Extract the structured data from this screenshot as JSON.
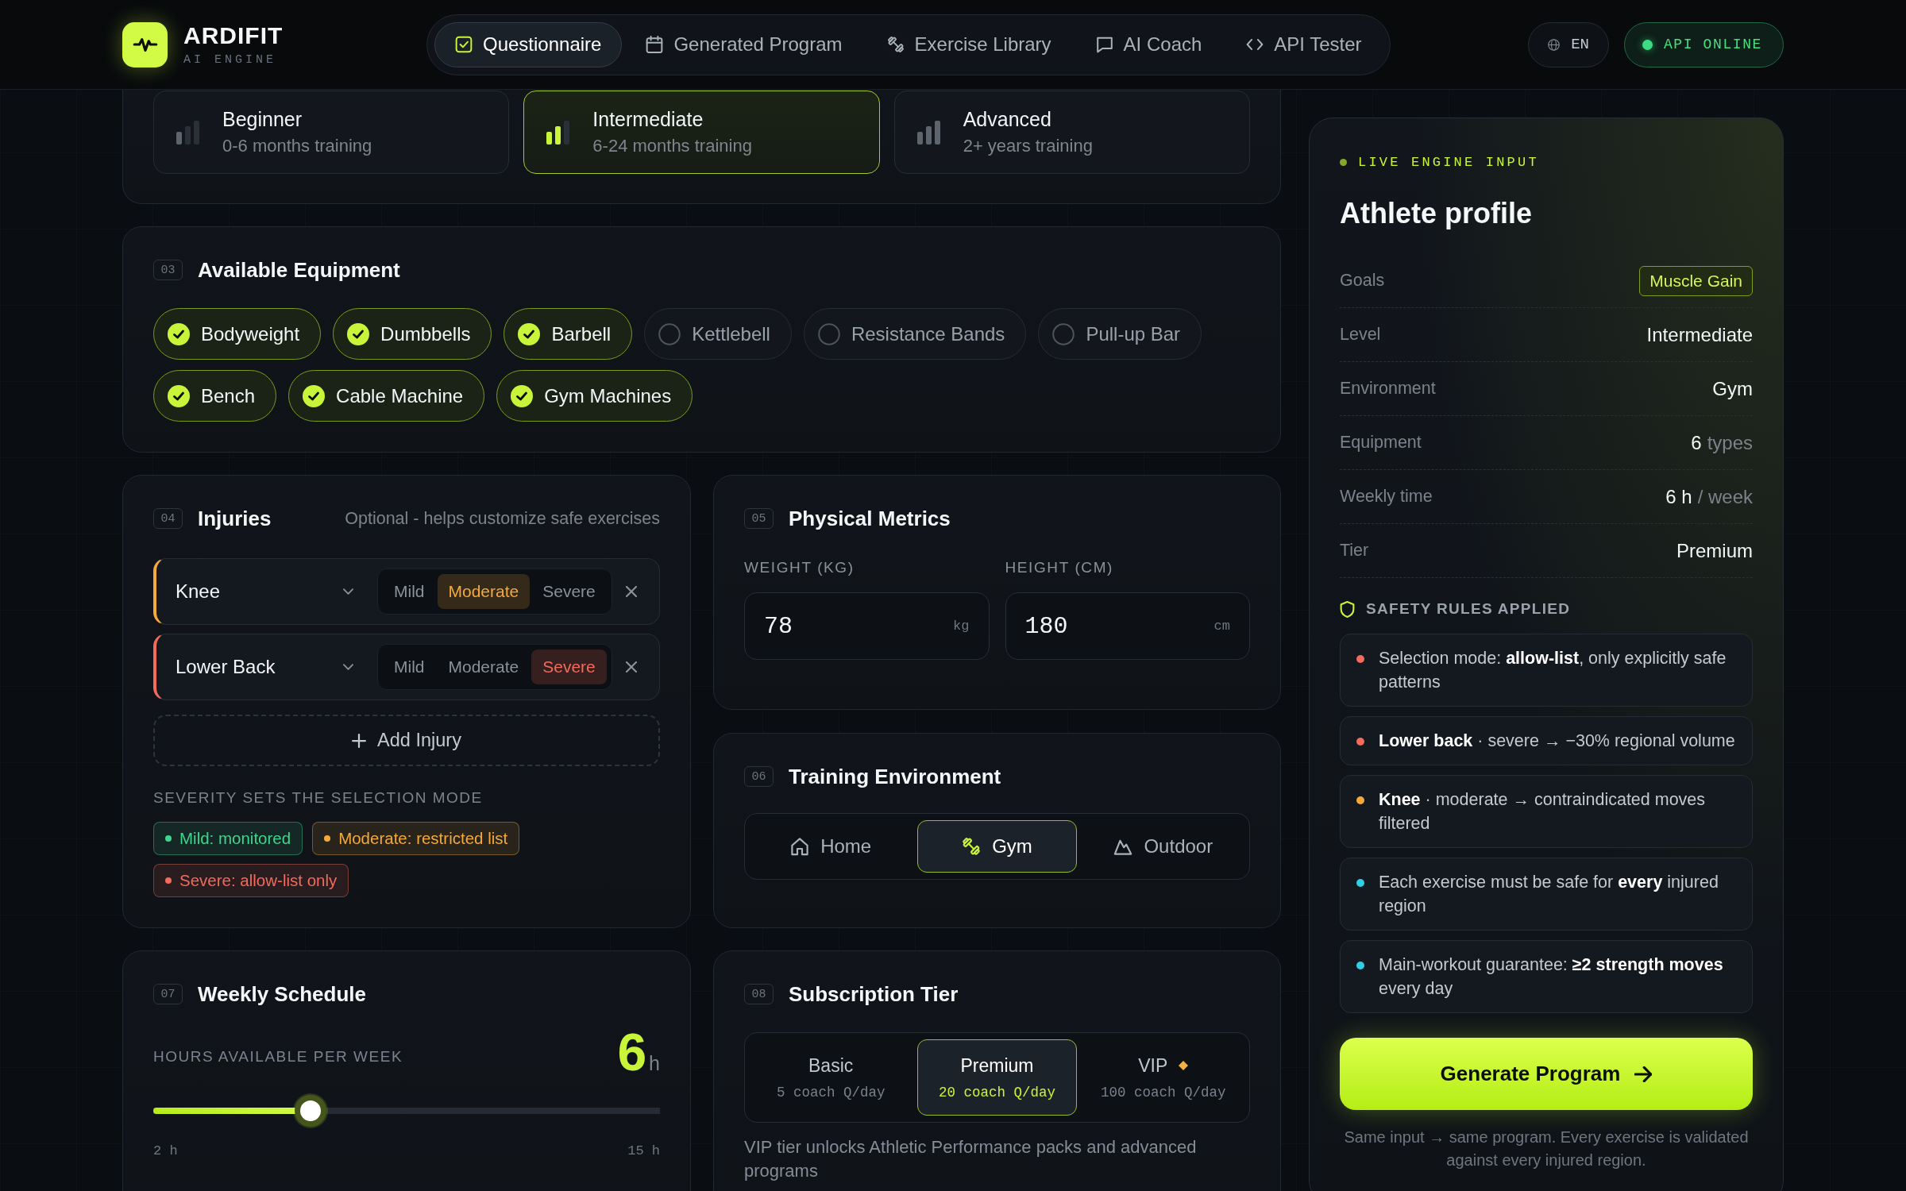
{
  "header": {
    "brand": {
      "name": "ARDIFIT",
      "tagline": "AI ENGINE"
    },
    "nav": [
      {
        "label": "Questionnaire",
        "selected": true
      },
      {
        "label": "Generated Program",
        "selected": false
      },
      {
        "label": "Exercise Library",
        "selected": false
      },
      {
        "label": "AI Coach",
        "selected": false
      },
      {
        "label": "API Tester",
        "selected": false
      }
    ],
    "language": "EN",
    "api_status": {
      "label": "API ONLINE",
      "online": true
    }
  },
  "levels": [
    {
      "title": "Beginner",
      "subtitle": "0-6 months training",
      "selected": false
    },
    {
      "title": "Intermediate",
      "subtitle": "6-24 months training",
      "selected": true
    },
    {
      "title": "Advanced",
      "subtitle": "2+ years training",
      "selected": false
    }
  ],
  "equipment": {
    "number": "03",
    "title": "Available Equipment",
    "items": [
      {
        "label": "Bodyweight",
        "checked": true
      },
      {
        "label": "Dumbbells",
        "checked": true
      },
      {
        "label": "Barbell",
        "checked": true
      },
      {
        "label": "Kettlebell",
        "checked": false
      },
      {
        "label": "Resistance Bands",
        "checked": false
      },
      {
        "label": "Pull-up Bar",
        "checked": false
      },
      {
        "label": "Bench",
        "checked": true
      },
      {
        "label": "Cable Machine",
        "checked": true
      },
      {
        "label": "Gym Machines",
        "checked": true
      }
    ]
  },
  "injuries": {
    "number": "04",
    "title": "Injuries",
    "hint": "Optional - helps customize safe exercises",
    "rows": [
      {
        "region": "Knee",
        "severity": [
          {
            "label": "Mild",
            "kind": "mild",
            "selected": false
          },
          {
            "label": "Moderate",
            "kind": "moderate",
            "selected": true
          },
          {
            "label": "Severe",
            "kind": "severe",
            "selected": false
          }
        ]
      },
      {
        "region": "Lower Back",
        "severity": [
          {
            "label": "Mild",
            "kind": "mild",
            "selected": false
          },
          {
            "label": "Moderate",
            "kind": "moderate",
            "selected": false
          },
          {
            "label": "Severe",
            "kind": "severe",
            "selected": true
          }
        ]
      }
    ],
    "add_label": "Add Injury",
    "legend_title": "SEVERITY SETS THE SELECTION MODE",
    "legend": [
      {
        "label": "Mild: monitored",
        "color": "#3dd68c"
      },
      {
        "label": "Moderate: restricted list",
        "color": "#f5a93b"
      },
      {
        "label": "Severe: allow-list only",
        "color": "#f26b5b"
      }
    ]
  },
  "metrics": {
    "number": "05",
    "title": "Physical Metrics",
    "fields": [
      {
        "label": "WEIGHT (KG)",
        "value": "78",
        "unit": "kg"
      },
      {
        "label": "HEIGHT (CM)",
        "value": "180",
        "unit": "cm"
      }
    ]
  },
  "environment": {
    "number": "06",
    "title": "Training Environment",
    "options": [
      {
        "label": "Home",
        "selected": false
      },
      {
        "label": "Gym",
        "selected": true
      },
      {
        "label": "Outdoor",
        "selected": false
      }
    ]
  },
  "schedule": {
    "number": "07",
    "title": "Weekly Schedule",
    "label": "HOURS AVAILABLE PER WEEK",
    "value": "6",
    "unit": "h",
    "level": 0.31,
    "min_label": "2 h",
    "max_label": "15 h"
  },
  "tier": {
    "number": "08",
    "title": "Subscription Tier",
    "options": [
      {
        "name": "Basic",
        "quota": "5 coach Q/day",
        "featured": false,
        "selected": false
      },
      {
        "name": "Premium",
        "quota": "20 coach Q/day",
        "featured": false,
        "selected": true
      },
      {
        "name": "VIP",
        "quota": "100 coach Q/day",
        "featured": true,
        "selected": false
      }
    ],
    "note": "VIP tier unlocks Athletic Performance packs and advanced programs"
  },
  "profile": {
    "eyebrow": "LIVE ENGINE INPUT",
    "title": "Athlete profile",
    "rows": [
      {
        "label": "Goals",
        "kind": "badge",
        "value": "Muscle Gain"
      },
      {
        "label": "Level",
        "kind": "text",
        "value": "Intermediate"
      },
      {
        "label": "Environment",
        "kind": "text",
        "value": "Gym"
      },
      {
        "label": "Equipment",
        "kind": "text",
        "value": "6",
        "suffix": "types"
      },
      {
        "label": "Weekly time",
        "kind": "text",
        "value": "6 h",
        "suffix": "/ week"
      },
      {
        "label": "Tier",
        "kind": "text",
        "value": "Premium"
      }
    ],
    "safety_title": "SAFETY RULES APPLIED",
    "rules": [
      {
        "text": "Selection mode: **allow-list**, only explicitly safe patterns",
        "color": "#f26b5b"
      },
      {
        "text": "**Lower back** · severe → −30% regional volume",
        "color": "#f26b5b"
      },
      {
        "text": "**Knee** · moderate → contraindicated moves filtered",
        "color": "#f5a93b"
      },
      {
        "text": "Each exercise must be safe for **every** injured region",
        "color": "#2fd0e6"
      },
      {
        "text": "Main-workout guarantee: **≥2 strength moves** every day",
        "color": "#2fd0e6"
      }
    ],
    "button": "Generate Program",
    "footnote": "Same input → same program. Every exercise is validated against every injured region."
  }
}
